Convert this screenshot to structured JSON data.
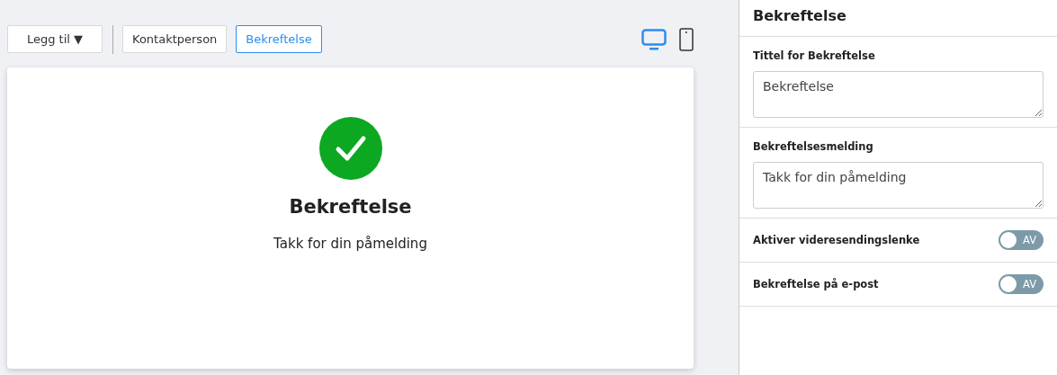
{
  "toolbar": {
    "add_button": {
      "label": "Legg til",
      "caret": "▼"
    },
    "tabs": [
      {
        "label": "Kontaktperson",
        "selected": false
      },
      {
        "label": "Bekreftelse",
        "selected": true
      }
    ],
    "devices": [
      {
        "kind": "desktop",
        "selected": true
      },
      {
        "kind": "mobile",
        "selected": false
      }
    ]
  },
  "preview": {
    "title": "Bekreftelse",
    "message": "Takk for din påmelding"
  },
  "panel": {
    "title": "Bekreftelse",
    "fields": [
      {
        "label": "Tittel for Bekreftelse",
        "value": "Bekreftelse"
      },
      {
        "label": "Bekreftelsesmelding",
        "value": "Takk for din påmelding"
      }
    ],
    "toggles": [
      {
        "label": "Aktiver videresendingslenke",
        "on": false,
        "state_text": "AV"
      },
      {
        "label": "Bekreftelse på e-post",
        "on": false,
        "state_text": "AV"
      }
    ]
  }
}
